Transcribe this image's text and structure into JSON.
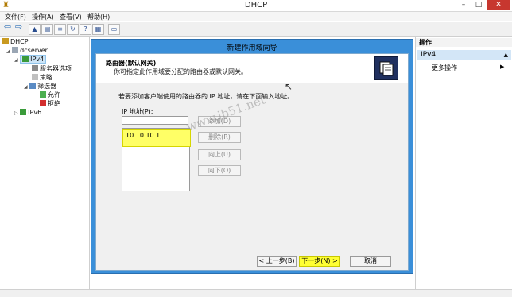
{
  "window": {
    "title": "DHCP",
    "min": "–",
    "max": "□",
    "close": "✕"
  },
  "menu": {
    "file": "文件(F)",
    "action": "操作(A)",
    "view": "查看(V)",
    "help": "帮助(H)"
  },
  "toolbar": {
    "back": "⇦",
    "forward": "⇨"
  },
  "tree": {
    "root": "DHCP",
    "server": "dcserver",
    "ipv4": "IPv4",
    "server_options": "服务器选项",
    "policies": "策略",
    "filters": "筛选器",
    "allow": "允许",
    "deny": "拒绝",
    "ipv6": "IPv6"
  },
  "actions": {
    "header": "操作",
    "ipv4": "IPv4",
    "more": "更多操作"
  },
  "wizard": {
    "title": "新建作用域向导",
    "head_title": "路由器(默认网关)",
    "head_subtitle": "你可指定此作用域要分配的路由器或默认网关。",
    "instruction": "若要添加客户端使用的路由器的 IP 地址，请在下面输入地址。",
    "ip_label": "IP 地址(P):",
    "ip_input_value": ". . .",
    "ip_entries": [
      "10.10.10.1"
    ],
    "add": "添加(D)",
    "remove": "删除(R)",
    "up": "向上(U)",
    "down": "向下(O)",
    "back": "< 上一步(B)",
    "next": "下一步(N) >",
    "cancel": "取消"
  },
  "watermark": "www.jb51.net",
  "colors": {
    "wizard_border": "#3a8fd9",
    "highlight": "#ffff33",
    "selection": "#cde5f7"
  }
}
